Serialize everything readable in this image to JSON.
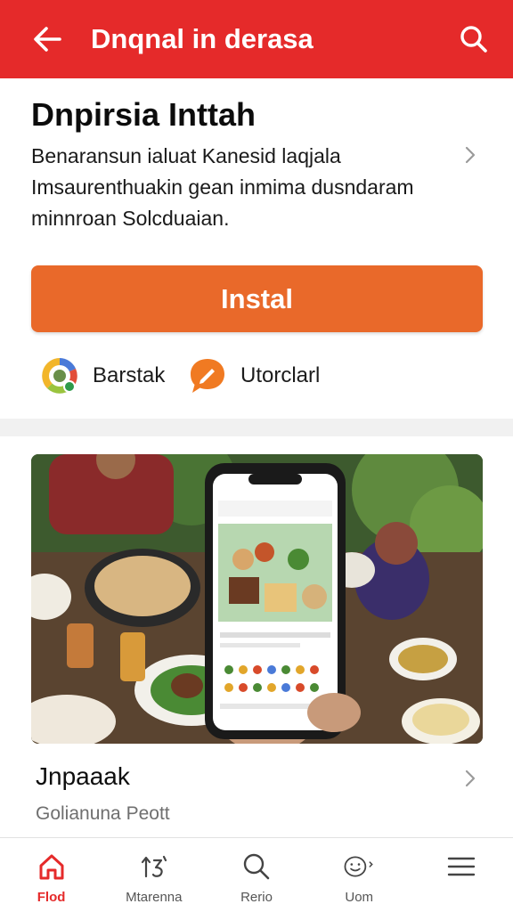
{
  "header": {
    "title": "Dnqnal in derasa",
    "accent_color": "#e52a2a",
    "back_icon": "arrow-left-icon",
    "search_icon": "search-icon"
  },
  "app": {
    "title": "Dnpirsia Inttah",
    "description": [
      "Benaransun ialuat  Kanesid laqjala",
      "Imsaurenthuakin gean inmima dusndaram",
      "minnroan Solcduaian."
    ],
    "install_label": "Instal",
    "install_color": "#e9692a",
    "meta": [
      {
        "label": "Barstak",
        "icon": "rating-badge-icon"
      },
      {
        "label": "Utorclarl",
        "icon": "chat-bubble-icon"
      }
    ]
  },
  "feature": {
    "image": "phone-app-food-table-photo",
    "title": "Jnpaaak",
    "subtitle": "Golianuna Peott"
  },
  "bottom_nav": [
    {
      "label": "Flod",
      "icon": "home-icon",
      "active": true
    },
    {
      "label": "Mtarenna",
      "icon": "refresh-icon",
      "active": false
    },
    {
      "label": "Rerio",
      "icon": "search-icon",
      "active": false
    },
    {
      "label": "Uom",
      "icon": "smiley-icon",
      "active": false
    },
    {
      "label": "",
      "icon": "menu-icon",
      "active": false
    }
  ]
}
